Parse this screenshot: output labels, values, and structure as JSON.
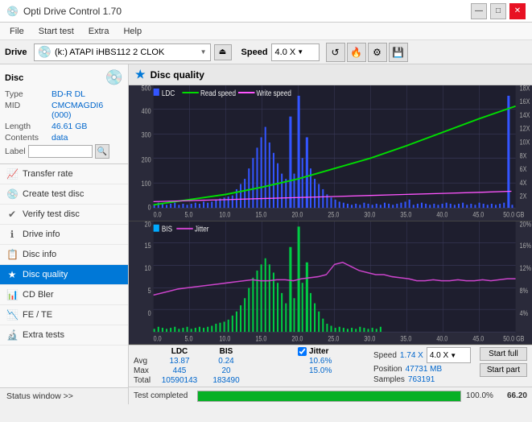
{
  "titlebar": {
    "title": "Opti Drive Control 1.70",
    "icon": "💿",
    "minimize_label": "—",
    "maximize_label": "□",
    "close_label": "✕"
  },
  "menubar": {
    "items": [
      {
        "label": "File"
      },
      {
        "label": "Start test"
      },
      {
        "label": "Extra"
      },
      {
        "label": "Help"
      }
    ]
  },
  "drivebar": {
    "drive_label": "Drive",
    "drive_value": "(k:)  ATAPI iHBS112  2 CLOK",
    "speed_label": "Speed",
    "speed_value": "4.0 X",
    "eject_icon": "⏏"
  },
  "disc_info": {
    "type_label": "Type",
    "type_value": "BD-R DL",
    "mid_label": "MID",
    "mid_value": "CMCMAGDI6 (000)",
    "length_label": "Length",
    "length_value": "46.61 GB",
    "contents_label": "Contents",
    "contents_value": "data",
    "label_label": "Label",
    "label_value": ""
  },
  "nav": {
    "items": [
      {
        "label": "Transfer rate",
        "icon": "📈"
      },
      {
        "label": "Create test disc",
        "icon": "💿"
      },
      {
        "label": "Verify test disc",
        "icon": "✔"
      },
      {
        "label": "Drive info",
        "icon": "ℹ"
      },
      {
        "label": "Disc info",
        "icon": "📋"
      },
      {
        "label": "Disc quality",
        "icon": "★",
        "active": true
      },
      {
        "label": "CD Bler",
        "icon": "📊"
      },
      {
        "label": "FE / TE",
        "icon": "📉"
      },
      {
        "label": "Extra tests",
        "icon": "🔬"
      }
    ]
  },
  "status_window": {
    "label": "Status window >>",
    "status_text": "Test completed"
  },
  "disc_quality": {
    "title": "Disc quality",
    "legend_top": [
      {
        "label": "LDC",
        "color": "#3355ff"
      },
      {
        "label": "Read speed",
        "color": "#00dd00"
      },
      {
        "label": "Write speed",
        "color": "#ff55ff"
      }
    ],
    "legend_bottom": [
      {
        "label": "BIS",
        "color": "#00aaff"
      },
      {
        "label": "Jitter",
        "color": "#dd44dd"
      }
    ],
    "top_chart": {
      "y_max": 500,
      "y_labels": [
        "500",
        "400",
        "300",
        "200",
        "100",
        "0"
      ],
      "y_right_labels": [
        "18X",
        "16X",
        "14X",
        "12X",
        "10X",
        "8X",
        "6X",
        "4X",
        "2X"
      ],
      "x_labels": [
        "0.0",
        "5.0",
        "10.0",
        "15.0",
        "20.0",
        "25.0",
        "30.0",
        "35.0",
        "40.0",
        "45.0",
        "50.0 GB"
      ]
    },
    "bottom_chart": {
      "y_max": 20,
      "y_labels": [
        "20",
        "15",
        "10",
        "5",
        "0"
      ],
      "y_right_labels": [
        "20%",
        "16%",
        "12%",
        "8%",
        "4%"
      ],
      "x_labels": [
        "0.0",
        "5.0",
        "10.0",
        "15.0",
        "20.0",
        "25.0",
        "30.0",
        "35.0",
        "40.0",
        "45.0",
        "50.0 GB"
      ]
    }
  },
  "stats": {
    "jitter_checked": true,
    "jitter_label": "Jitter",
    "ldc_label": "LDC",
    "bis_label": "BIS",
    "avg_label": "Avg",
    "max_label": "Max",
    "total_label": "Total",
    "ldc_avg": "13.87",
    "ldc_max": "445",
    "ldc_total": "10590143",
    "bis_avg": "0.24",
    "bis_max": "20",
    "bis_total": "183490",
    "jitter_avg": "10.6%",
    "jitter_max": "15.0%",
    "speed_label": "Speed",
    "speed_value": "1.74 X",
    "position_label": "Position",
    "position_value": "47731 MB",
    "samples_label": "Samples",
    "samples_value": "763191",
    "speed_select": "4.0 X",
    "start_full_label": "Start full",
    "start_part_label": "Start part"
  },
  "progress": {
    "status_text": "Test completed",
    "percent": 100,
    "percent_text": "100.0%",
    "score_text": "66.20"
  }
}
